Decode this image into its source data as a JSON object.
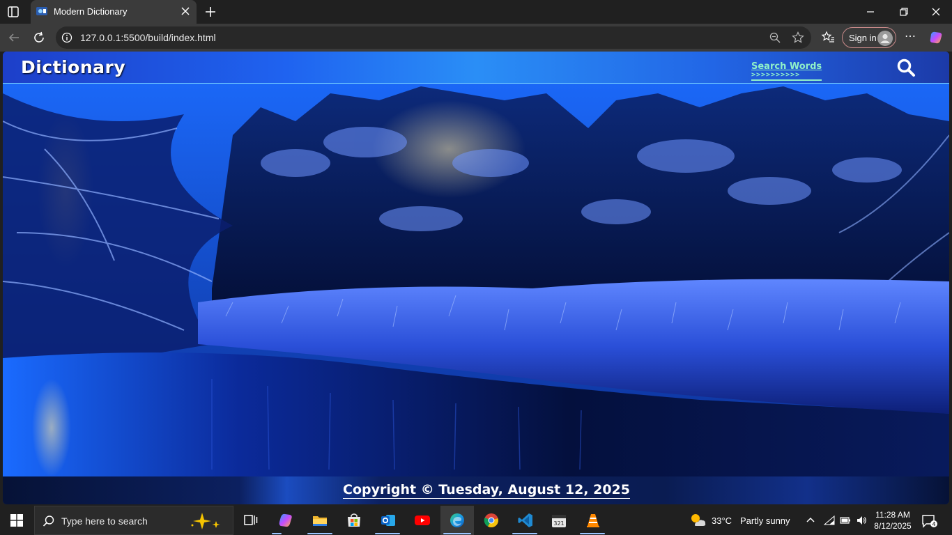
{
  "browser": {
    "tab_title": "Modern Dictionary",
    "url": "127.0.0.1:5500/build/index.html",
    "signin_label": "Sign in"
  },
  "page": {
    "logo": "Dictionary",
    "search_words_label": "Search Words",
    "search_words_arrows": ">>>>>>>>>>",
    "copyright": "Copyright © Tuesday, August 12, 2025"
  },
  "taskbar": {
    "search_placeholder": "Type here to search",
    "weather_temp": "33°C",
    "weather_desc": "Partly sunny",
    "time": "11:28 AM",
    "date": "8/12/2025",
    "notification_count": "4"
  },
  "colors": {
    "header_accent": "#1f63f0",
    "search_link": "#8ff0c8",
    "edge_accent": "#9ac4ff"
  }
}
